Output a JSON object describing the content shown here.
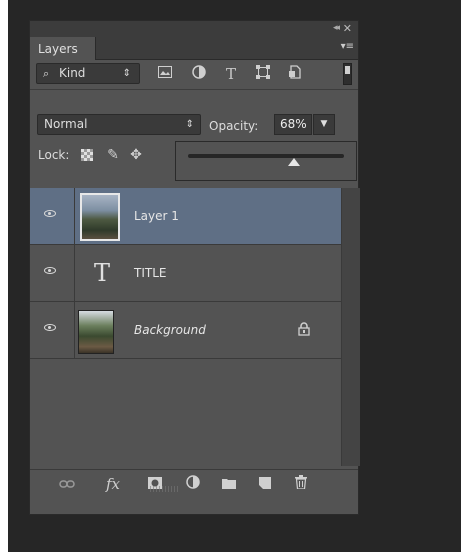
{
  "panel": {
    "tab_label": "Layers",
    "collapse_glyph": "◂◂",
    "close_glyph": "✕",
    "menu_glyph": "▾≡"
  },
  "filter": {
    "kind_label": "Kind",
    "search_glyph": "⌕",
    "arrows_glyph": "⇕",
    "icons": [
      "image-filter-icon",
      "adjustment-filter-icon",
      "type-filter-icon",
      "shape-filter-icon",
      "smart-object-filter-icon"
    ],
    "type_glyph": "T"
  },
  "blend": {
    "mode": "Normal",
    "arrows_glyph": "⇕",
    "opacity_label": "Opacity:",
    "opacity_value": "68%",
    "opacity_fraction": 0.68,
    "dropdown_glyph": "▼"
  },
  "lock": {
    "label": "Lock:",
    "brush_glyph": "✎",
    "move_glyph": "✥"
  },
  "layers": [
    {
      "name": "Layer 1",
      "kind": "image",
      "selected": true,
      "visible": true
    },
    {
      "name": "TITLE",
      "kind": "type",
      "selected": false,
      "visible": true
    },
    {
      "name": "Background",
      "kind": "image",
      "selected": false,
      "visible": true,
      "locked": true
    }
  ],
  "type_layer_glyph": "T",
  "lock_badge_glyph": "🔒",
  "bottom_bar": {
    "link_glyph": "⛓",
    "fx_label": "fx",
    "mask_glyph": "◘",
    "adjust_glyph": "◐",
    "folder_glyph": "▬",
    "new_layer_glyph": "◳",
    "trash_glyph": "🗑"
  },
  "colors": {
    "panel_bg": "#535353",
    "selected_row": "#5f6f85",
    "canvas_bg": "#262626"
  }
}
